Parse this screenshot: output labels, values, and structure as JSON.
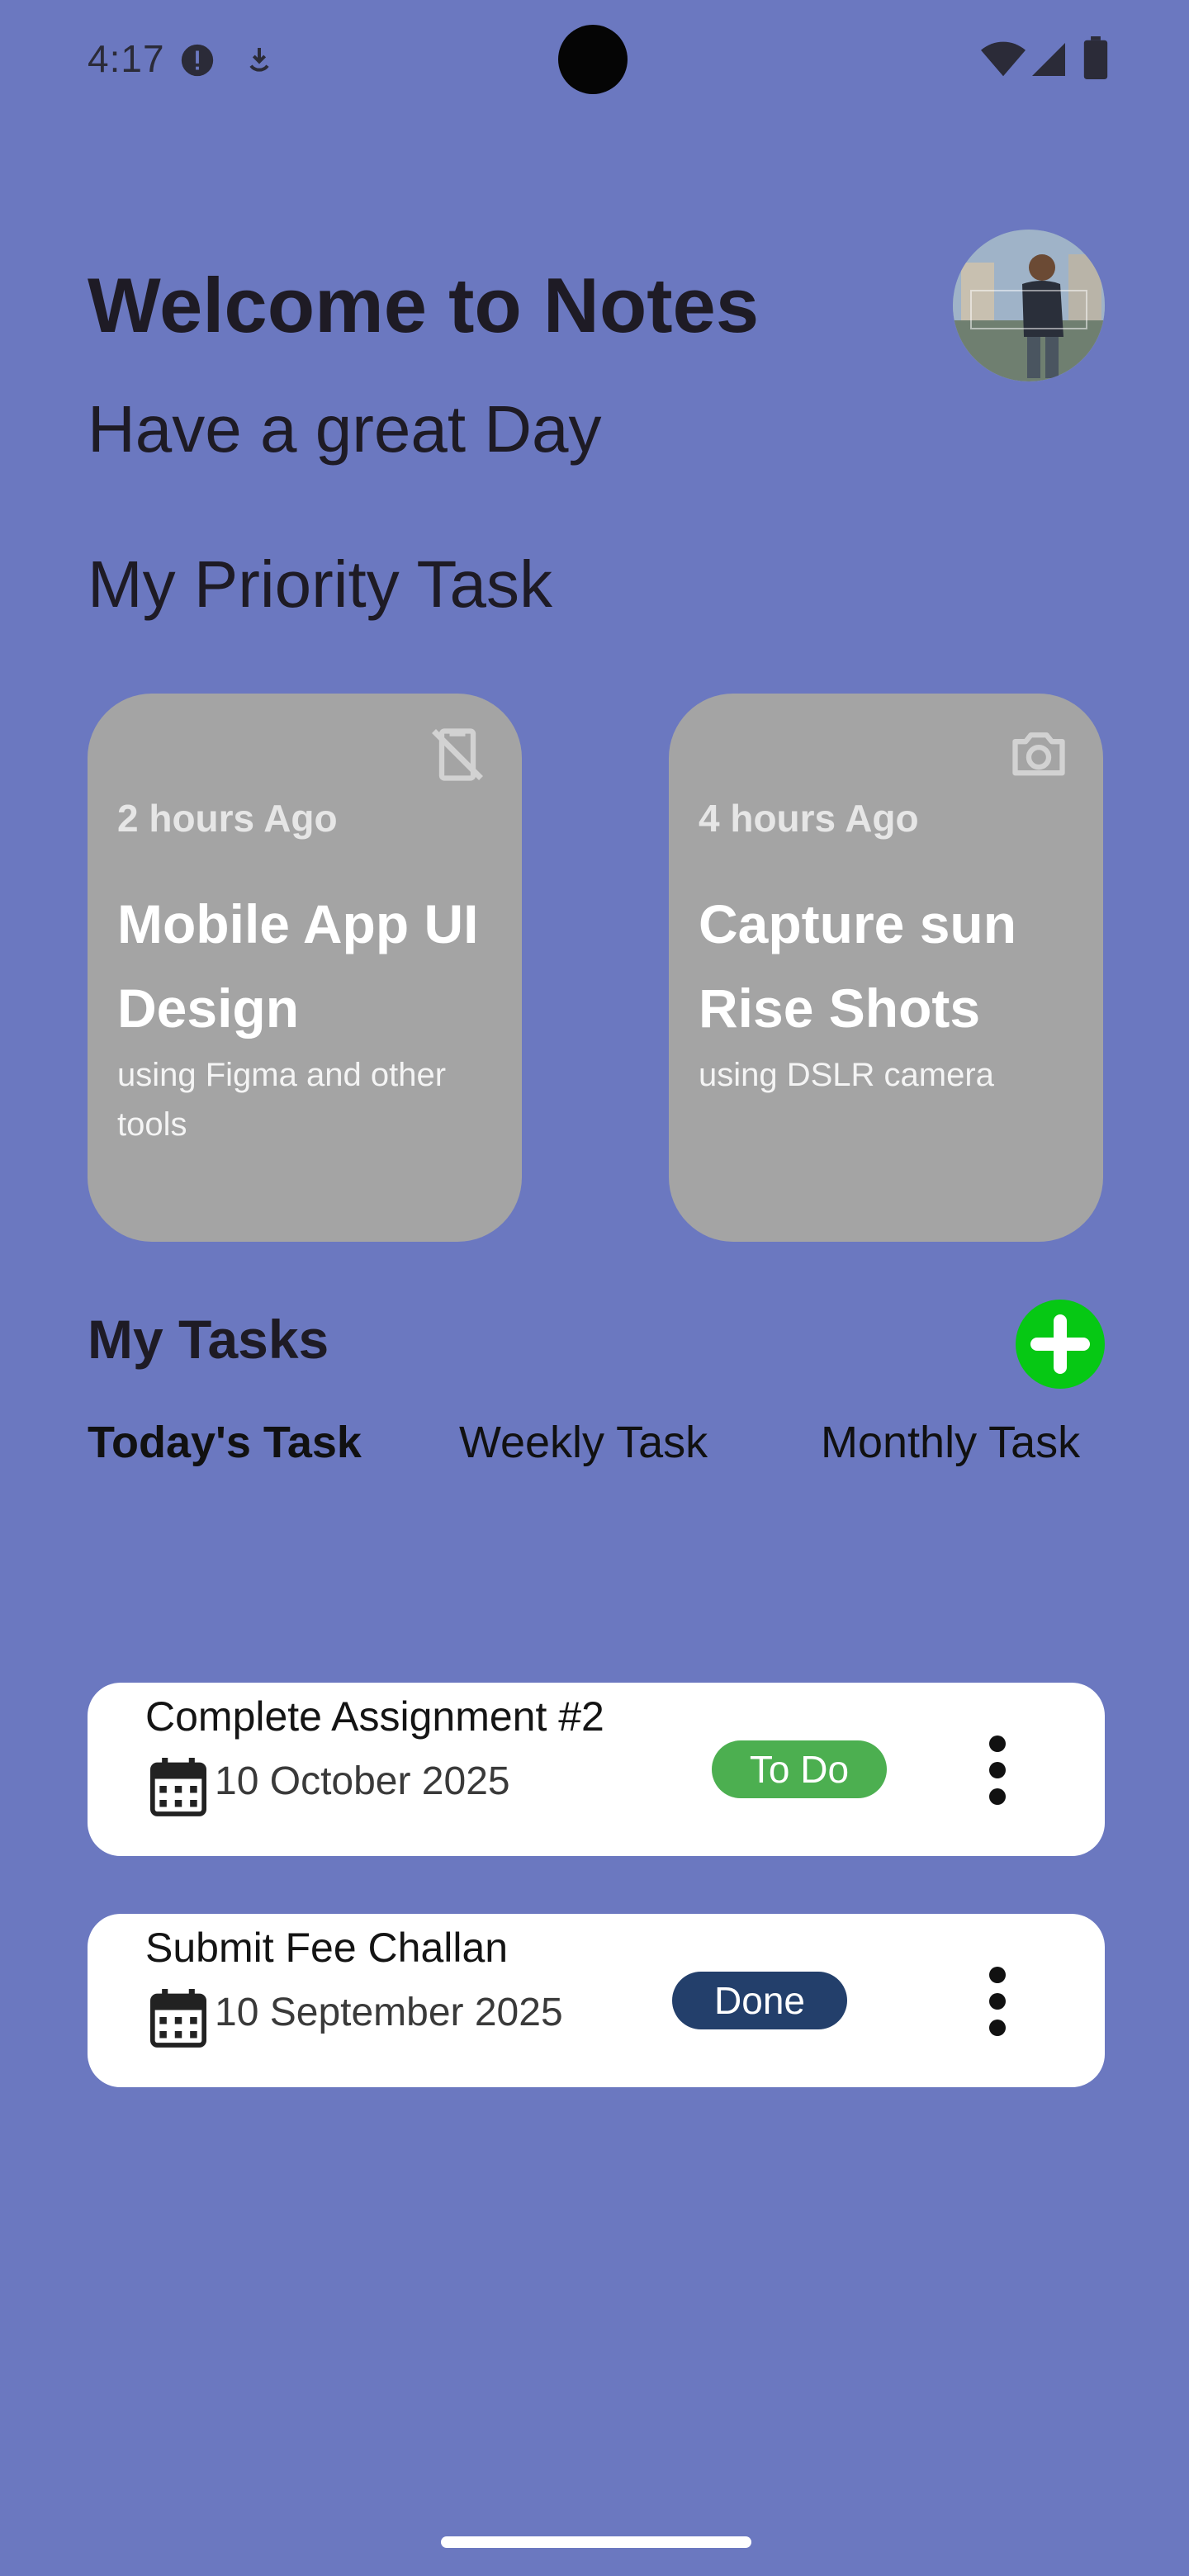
{
  "status_bar": {
    "time": "4:17",
    "icons": [
      "alert-circle-icon",
      "download-icon",
      "wifi-icon",
      "signal-icon",
      "battery-icon"
    ]
  },
  "header": {
    "title": "Welcome to Notes",
    "subtitle": "Have a great Day",
    "avatar_icon": "profile-photo"
  },
  "priority": {
    "heading": "My Priority Task",
    "cards": [
      {
        "time_ago": "2 hours Ago",
        "title": "Mobile App UI Design",
        "description": "using Figma and other tools",
        "icon": "mobile-off-icon"
      },
      {
        "time_ago": "4 hours Ago",
        "title": "Capture sun Rise Shots",
        "description": "using DSLR camera",
        "icon": "camera-icon"
      }
    ]
  },
  "tasks": {
    "heading": "My Tasks",
    "add_icon": "plus-circle-icon",
    "tabs": [
      {
        "label": "Today's Task",
        "selected": true
      },
      {
        "label": "Weekly Task",
        "selected": false
      },
      {
        "label": "Monthly Task",
        "selected": false
      }
    ],
    "items": [
      {
        "title": "Complete Assignment #2",
        "date": "10 October 2025",
        "status": "To Do",
        "status_color": "#4caf50"
      },
      {
        "title": "Submit Fee Challan",
        "date": "10 September 2025",
        "status": "Done",
        "status_color": "#233f6b"
      }
    ]
  },
  "colors": {
    "background": "#6b78c0",
    "card_gray": "#a4a4a4",
    "add_button": "#06c814"
  }
}
